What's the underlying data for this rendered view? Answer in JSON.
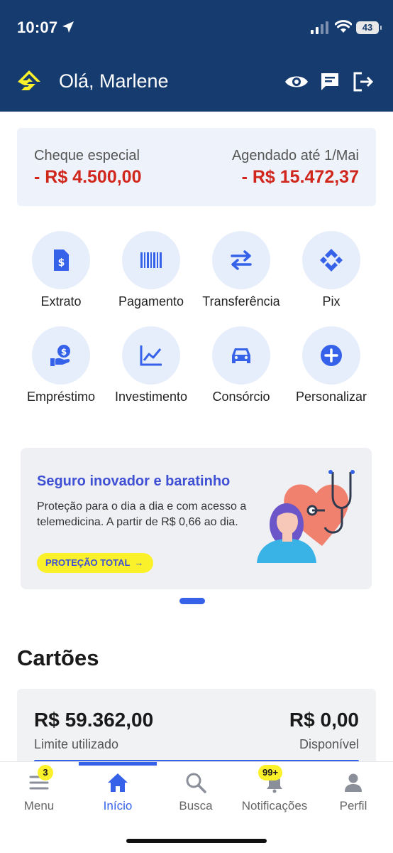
{
  "status_bar": {
    "time": "10:07",
    "battery": "43"
  },
  "header": {
    "greeting": "Olá, Marlene"
  },
  "balance": {
    "overdraft_label": "Cheque especial",
    "overdraft_value": "- R$ 4.500,00",
    "scheduled_label": "Agendado até 1/Mai",
    "scheduled_value": "- R$ 15.472,37",
    "value_color": "#d0261c"
  },
  "shortcuts": [
    {
      "label": "Extrato",
      "icon": "statement-icon"
    },
    {
      "label": "Pagamento",
      "icon": "barcode-icon"
    },
    {
      "label": "Transferência",
      "icon": "transfer-icon"
    },
    {
      "label": "Pix",
      "icon": "pix-icon"
    },
    {
      "label": "Empréstimo",
      "icon": "loan-icon"
    },
    {
      "label": "Investimento",
      "icon": "chart-line-icon"
    },
    {
      "label": "Consórcio",
      "icon": "car-icon"
    },
    {
      "label": "Personalizar",
      "icon": "plus-circle-icon"
    }
  ],
  "promo": {
    "title": "Seguro inovador e baratinho",
    "text": "Proteção para o dia a dia e com acesso a telemedicina. A partir de R$ 0,66 ao dia.",
    "button": "PROTEÇÃO TOTAL"
  },
  "cards": {
    "section_title": "Cartões",
    "used_value": "R$ 59.362,00",
    "used_label": "Limite utilizado",
    "available_value": "R$ 0,00",
    "available_label": "Disponível"
  },
  "tabbar": {
    "items": [
      {
        "label": "Menu",
        "icon": "menu-icon",
        "badge": "3"
      },
      {
        "label": "Início",
        "icon": "home-icon",
        "active": true
      },
      {
        "label": "Busca",
        "icon": "search-icon"
      },
      {
        "label": "Notificações",
        "icon": "bell-icon",
        "badge": "99+"
      },
      {
        "label": "Perfil",
        "icon": "person-icon"
      }
    ]
  },
  "colors": {
    "header_bg": "#163b6e",
    "accent_blue": "#3662ea",
    "brand_yellow": "#fbf12b"
  }
}
